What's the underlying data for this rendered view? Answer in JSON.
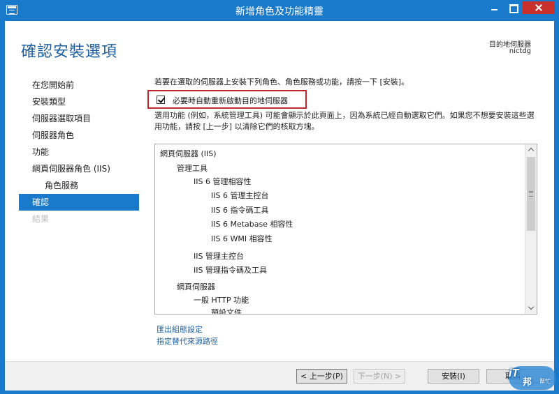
{
  "window": {
    "title": "新增角色及功能精靈"
  },
  "page": {
    "title": "確認安裝選項",
    "destination_label": "目的地伺服器",
    "destination_value": "nictdg"
  },
  "nav": {
    "items": [
      {
        "label": "在您開始前",
        "state": "normal",
        "level": 0
      },
      {
        "label": "安裝類型",
        "state": "normal",
        "level": 0
      },
      {
        "label": "伺服器選取項目",
        "state": "normal",
        "level": 0
      },
      {
        "label": "伺服器角色",
        "state": "normal",
        "level": 0
      },
      {
        "label": "功能",
        "state": "normal",
        "level": 0
      },
      {
        "label": "網頁伺服器角色 (IIS)",
        "state": "normal",
        "level": 0
      },
      {
        "label": "角色服務",
        "state": "normal",
        "level": 1
      },
      {
        "label": "確認",
        "state": "active",
        "level": 0
      },
      {
        "label": "結果",
        "state": "disabled",
        "level": 0
      }
    ]
  },
  "content": {
    "intro": "若要在選取的伺服器上安裝下列角色、角色服務或功能，請按一下 [安裝]。",
    "restart_checkbox_label": "必要時自動重新啟動目的地伺服器",
    "restart_checked": true,
    "note": "選用功能 (例如，系統管理工具) 可能會顯示於此頁面上，因為系統已經自動選取它們。如果您不想要安裝這些選用功能，請按 [上一步] 以清除它們的核取方塊。",
    "list": [
      {
        "text": "網頁伺服器 (IIS)",
        "level": 0
      },
      {
        "text": "管理工具",
        "level": 1
      },
      {
        "text": "IIS 6 管理相容性",
        "level": 2
      },
      {
        "text": "IIS 6 管理主控台",
        "level": 3
      },
      {
        "text": "IIS 6 指令碼工具",
        "level": 3
      },
      {
        "text": "IIS 6 Metabase 相容性",
        "level": 3
      },
      {
        "text": "IIS 6 WMI 相容性",
        "level": 3
      },
      {
        "text": "IIS 管理主控台",
        "level": 2
      },
      {
        "text": "IIS 管理指令碼及工具",
        "level": 2
      },
      {
        "text": "網頁伺服器",
        "level": 1
      },
      {
        "text": "一般 HTTP 功能",
        "level": 2
      },
      {
        "text": "預設文件",
        "level": 3
      }
    ],
    "export_link": "匯出組態設定",
    "alt_source_link": "指定替代來源路徑"
  },
  "footer": {
    "prev_label": "< 上一步(P)",
    "next_label": "下一步(N) >",
    "install_label": "安裝(I)",
    "cancel_label": "取消"
  },
  "watermark": {
    "brand": "iT",
    "name": "邦",
    "sub": "幫忙"
  },
  "colors": {
    "accent": "#1979ca",
    "title_text": "#1e5fa1",
    "highlight_border": "#c0282e",
    "close_button": "#c7302b"
  }
}
